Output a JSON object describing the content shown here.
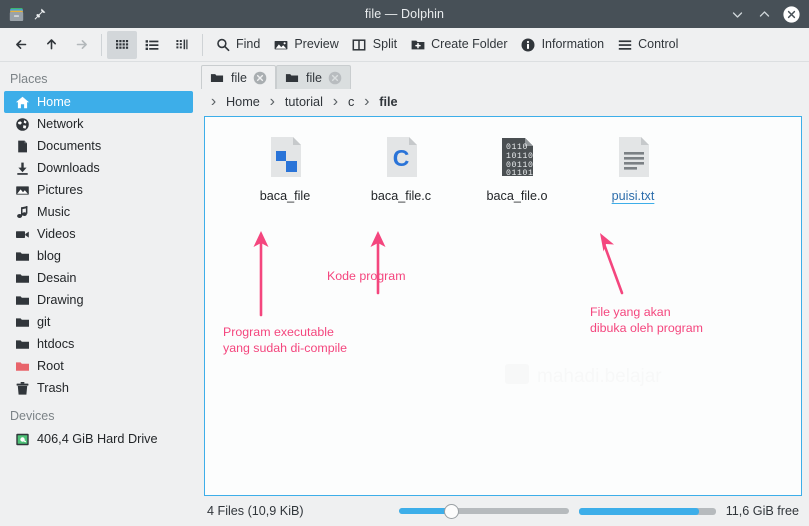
{
  "window": {
    "title": "file — Dolphin",
    "app_icon": "dolphin-icon",
    "pin_icon": "pin-icon",
    "controls": [
      {
        "name": "minimize-button",
        "icon": "chevron-down-icon"
      },
      {
        "name": "maximize-button",
        "icon": "chevron-up-icon"
      },
      {
        "name": "close-button",
        "icon": "close-icon"
      }
    ],
    "titlebar_color": "#475057"
  },
  "toolbar": {
    "nav": [
      {
        "name": "back-button",
        "icon": "arrow-left-icon",
        "enabled": true
      },
      {
        "name": "up-button",
        "icon": "arrow-up-icon",
        "enabled": true
      },
      {
        "name": "forward-button",
        "icon": "arrow-right-icon",
        "enabled": false
      }
    ],
    "view_modes": [
      {
        "name": "view-mode-icons",
        "icon": "grid-icon",
        "active": true
      },
      {
        "name": "view-mode-details",
        "icon": "list-icon",
        "active": false
      },
      {
        "name": "view-mode-compact",
        "icon": "columns-icon",
        "active": false
      }
    ],
    "actions": [
      {
        "label": "Find",
        "icon": "search-icon"
      },
      {
        "label": "Preview",
        "icon": "image-icon"
      },
      {
        "label": "Split",
        "icon": "split-icon"
      },
      {
        "label": "Create Folder",
        "icon": "folder-plus-icon"
      },
      {
        "label": "Information",
        "icon": "info-icon"
      },
      {
        "label": "Control",
        "icon": "hamburger-icon"
      }
    ]
  },
  "sidebar": {
    "groups": [
      {
        "title": "Places",
        "items": [
          {
            "label": "Home",
            "icon": "home-icon",
            "selected": true
          },
          {
            "label": "Network",
            "icon": "network-icon",
            "selected": false
          },
          {
            "label": "Documents",
            "icon": "document-icon",
            "selected": false
          },
          {
            "label": "Downloads",
            "icon": "download-icon",
            "selected": false
          },
          {
            "label": "Pictures",
            "icon": "picture-icon",
            "selected": false
          },
          {
            "label": "Music",
            "icon": "music-icon",
            "selected": false
          },
          {
            "label": "Videos",
            "icon": "video-icon",
            "selected": false
          },
          {
            "label": "blog",
            "icon": "folder-icon",
            "selected": false
          },
          {
            "label": "Desain",
            "icon": "folder-icon",
            "selected": false
          },
          {
            "label": "Drawing",
            "icon": "folder-icon",
            "selected": false
          },
          {
            "label": "git",
            "icon": "folder-icon",
            "selected": false
          },
          {
            "label": "htdocs",
            "icon": "folder-icon",
            "selected": false
          },
          {
            "label": "Root",
            "icon": "folder-red-icon",
            "selected": false
          },
          {
            "label": "Trash",
            "icon": "trash-icon",
            "selected": false
          }
        ]
      },
      {
        "title": "Devices",
        "items": [
          {
            "label": "406,4 GiB Hard Drive",
            "icon": "harddrive-icon",
            "selected": false
          }
        ]
      }
    ]
  },
  "tabs": [
    {
      "label": "file",
      "icon": "folder-icon",
      "close_icon": "close-icon",
      "active": true
    },
    {
      "label": "file",
      "icon": "folder-icon",
      "close_icon": "close-icon",
      "active": false
    }
  ],
  "breadcrumb": {
    "separator": "›",
    "items": [
      {
        "label": "Home",
        "current": false
      },
      {
        "label": "tutorial",
        "current": false
      },
      {
        "label": "c",
        "current": false
      },
      {
        "label": "file",
        "current": true
      }
    ]
  },
  "files": [
    {
      "name": "baca_file",
      "icon": "executable-file-icon",
      "hovered": false
    },
    {
      "name": "baca_file.c",
      "icon": "c-source-file-icon",
      "hovered": false
    },
    {
      "name": "baca_file.o",
      "icon": "binary-file-icon",
      "hovered": false
    },
    {
      "name": "puisi.txt",
      "icon": "text-file-icon",
      "hovered": true
    }
  ],
  "annotations": {
    "color": "#f4467e",
    "items": [
      {
        "name": "annotation-executable",
        "text": "Program executable\nyang sudah di-compile"
      },
      {
        "name": "annotation-source",
        "text": "Kode program"
      },
      {
        "name": "annotation-datafile",
        "text": "File yang akan\ndibuka oleh program"
      }
    ]
  },
  "statusbar": {
    "summary": "4 Files (10,9 KiB)",
    "free_space": "11,6 GiB free",
    "zoom_value": 31,
    "capacity_used_pct": 88
  },
  "colors": {
    "accent": "#3daee9",
    "titlebar": "#475057",
    "chrome": "#eff0f1",
    "view_bg": "#fcfdfd",
    "annotation": "#f4467e"
  }
}
